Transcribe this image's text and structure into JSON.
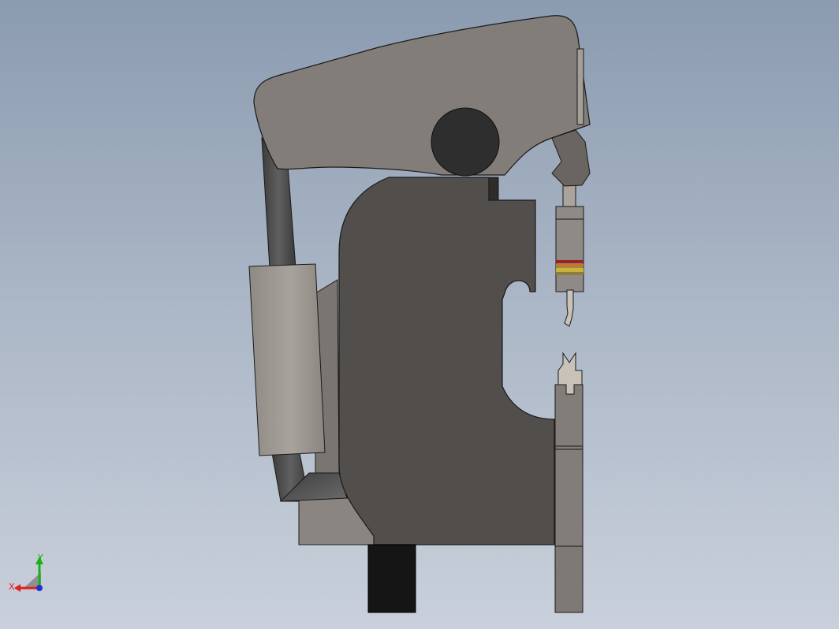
{
  "scene": {
    "background_top": "#8b9bb0",
    "background_bottom": "#c9d0db",
    "model": "press-machine-side-view"
  },
  "triad": {
    "x_label": "X",
    "y_label": "Y",
    "x_color": "#e02020",
    "y_color": "#18b018",
    "z_color": "#2030d0"
  },
  "colors": {
    "frame": "#524e4b",
    "head": "#827d79",
    "cylinder": "#9b968f",
    "column_dark": "#4a4a4a",
    "base_block": "#8a8580",
    "foot": "#151515",
    "outline": "#1a1a1a"
  }
}
